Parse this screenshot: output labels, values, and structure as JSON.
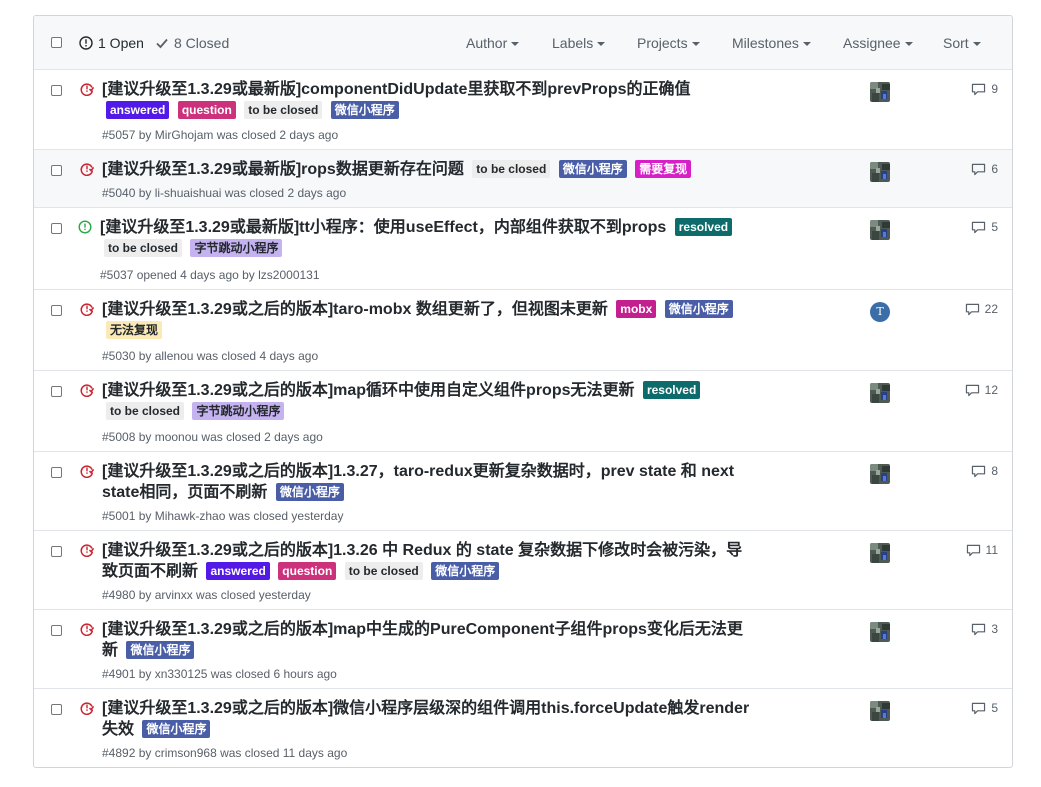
{
  "header": {
    "open_count": "1 Open",
    "closed_count": "8 Closed",
    "filters": [
      "Author",
      "Labels",
      "Projects",
      "Milestones",
      "Assignee",
      "Sort"
    ]
  },
  "colors": {
    "closed_icon": "#cb2431",
    "open_icon": "#28a745",
    "row_highlight": "#f6f8fa"
  },
  "issues": [
    {
      "state": "closed",
      "title": "[建议升级至1.3.29或最新版]componentDidUpdate里获取不到prevProps的正确值",
      "labels": [
        {
          "name": "answered",
          "bg": "#5319e7",
          "fg": "#ffffff"
        },
        {
          "name": "question",
          "bg": "#cc317c",
          "fg": "#ffffff"
        },
        {
          "name": "to be closed",
          "bg": "#ededed",
          "fg": "#24292e"
        },
        {
          "name": "微信小程序",
          "bg": "#4a5ea8",
          "fg": "#ffffff"
        }
      ],
      "meta": "#5057 by MirGhojam was closed 2 days ago",
      "comments": "9",
      "avatar": "image"
    },
    {
      "state": "closed",
      "title": "[建议升级至1.3.29或最新版]rops数据更新存在问题",
      "labels": [
        {
          "name": "to be closed",
          "bg": "#ededed",
          "fg": "#24292e"
        },
        {
          "name": "微信小程序",
          "bg": "#4a5ea8",
          "fg": "#ffffff"
        },
        {
          "name": "需要复现",
          "bg": "#d61fc7",
          "fg": "#ffffff"
        }
      ],
      "meta": "#5040 by li-shuaishuai was closed 2 days ago",
      "comments": "6",
      "avatar": "image"
    },
    {
      "state": "open",
      "title": "[建议升级至1.3.29或最新版]tt小程序：使用useEffect，内部组件获取不到props",
      "labels": [
        {
          "name": "resolved",
          "bg": "#0e6b6b",
          "fg": "#ffffff"
        },
        {
          "name": "to be closed",
          "bg": "#ededed",
          "fg": "#24292e"
        },
        {
          "name": "字节跳动小程序",
          "bg": "#c5b3f0",
          "fg": "#24292e"
        }
      ],
      "meta": "#5037 opened 4 days ago by lzs2000131",
      "comments": "5",
      "avatar": "image"
    },
    {
      "state": "closed",
      "title": "[建议升级至1.3.29或之后的版本]taro-mobx 数组更新了，但视图未更新",
      "labels": [
        {
          "name": "mobx",
          "bg": "#c41f8f",
          "fg": "#ffffff"
        },
        {
          "name": "微信小程序",
          "bg": "#4a5ea8",
          "fg": "#ffffff"
        },
        {
          "name": "无法复现",
          "bg": "#fbeab5",
          "fg": "#24292e"
        }
      ],
      "meta": "#5030 by allenou was closed 4 days ago",
      "comments": "22",
      "avatar": "letter",
      "avatar_letter": "T"
    },
    {
      "state": "closed",
      "title": "[建议升级至1.3.29或之后的版本]map循环中使用自定义组件props无法更新",
      "labels": [
        {
          "name": "resolved",
          "bg": "#0e6b6b",
          "fg": "#ffffff"
        },
        {
          "name": "to be closed",
          "bg": "#ededed",
          "fg": "#24292e"
        },
        {
          "name": "字节跳动小程序",
          "bg": "#c5b3f0",
          "fg": "#24292e"
        }
      ],
      "meta": "#5008 by moonou was closed 2 days ago",
      "comments": "12",
      "avatar": "image"
    },
    {
      "state": "closed",
      "title": "[建议升级至1.3.29或之后的版本]1.3.27，taro-redux更新复杂数据时，prev state 和 next state相同，页面不刷新",
      "labels": [
        {
          "name": "微信小程序",
          "bg": "#4a5ea8",
          "fg": "#ffffff"
        }
      ],
      "meta": "#5001 by Mihawk-zhao was closed yesterday",
      "comments": "8",
      "avatar": "image"
    },
    {
      "state": "closed",
      "title": "[建议升级至1.3.29或之后的版本]1.3.26 中 Redux 的 state 复杂数据下修改时会被污染，导致页面不刷新",
      "labels": [
        {
          "name": "answered",
          "bg": "#5319e7",
          "fg": "#ffffff"
        },
        {
          "name": "question",
          "bg": "#cc317c",
          "fg": "#ffffff"
        },
        {
          "name": "to be closed",
          "bg": "#ededed",
          "fg": "#24292e"
        },
        {
          "name": "微信小程序",
          "bg": "#4a5ea8",
          "fg": "#ffffff"
        }
      ],
      "meta": "#4980 by arvinxx was closed yesterday",
      "comments": "11",
      "avatar": "image"
    },
    {
      "state": "closed",
      "title": "[建议升级至1.3.29或之后的版本]map中生成的PureComponent子组件props变化后无法更新",
      "labels": [
        {
          "name": "微信小程序",
          "bg": "#4a5ea8",
          "fg": "#ffffff"
        }
      ],
      "meta": "#4901 by xn330125 was closed 6 hours ago",
      "comments": "3",
      "avatar": "image"
    },
    {
      "state": "closed",
      "title": "[建议升级至1.3.29或之后的版本]微信小程序层级深的组件调用this.forceUpdate触发render失效",
      "labels": [
        {
          "name": "微信小程序",
          "bg": "#4a5ea8",
          "fg": "#ffffff"
        }
      ],
      "meta": "#4892 by crimson968 was closed 11 days ago",
      "comments": "5",
      "avatar": "image"
    }
  ]
}
